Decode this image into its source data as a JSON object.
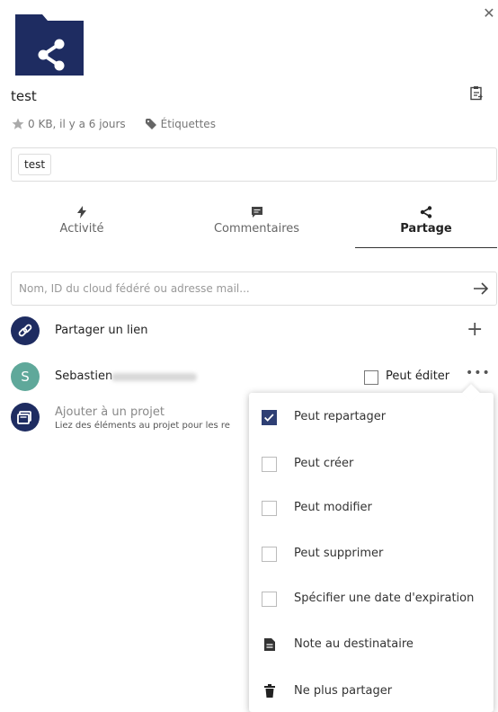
{
  "file": {
    "name": "test",
    "meta": "0 KB, il y a 6 jours",
    "tags_label": "Étiquettes",
    "tags": [
      "test"
    ]
  },
  "tabs": [
    {
      "label": "Activité",
      "icon": "bolt-icon"
    },
    {
      "label": "Commentaires",
      "icon": "comment-icon"
    },
    {
      "label": "Partage",
      "icon": "share-icon",
      "active": true
    }
  ],
  "share_input": {
    "placeholder": "Nom, ID du cloud fédéré ou adresse mail...",
    "value": ""
  },
  "link_share": {
    "label": "Partager un lien"
  },
  "user_share": {
    "initial": "S",
    "name": "Sebastien",
    "can_edit_label": "Peut éditer",
    "can_edit": false,
    "avatar_color": "#5fa89a"
  },
  "project": {
    "title": "Ajouter à un projet",
    "subtitle": "Liez des éléments au projet pour les re"
  },
  "menu": {
    "items": [
      {
        "label": "Peut repartager",
        "type": "checkbox",
        "checked": true
      },
      {
        "label": "Peut créer",
        "type": "checkbox",
        "checked": false
      },
      {
        "label": "Peut modifier",
        "type": "checkbox",
        "checked": false
      },
      {
        "label": "Peut supprimer",
        "type": "checkbox",
        "checked": false
      },
      {
        "label": "Spécifier une date d'expiration",
        "type": "checkbox",
        "checked": false
      },
      {
        "label": "Note au destinataire",
        "type": "action",
        "icon": "note-icon"
      },
      {
        "label": "Ne plus partager",
        "type": "action",
        "icon": "trash-icon"
      }
    ]
  },
  "colors": {
    "brand": "#1e2c61",
    "checkbox_checked": "#2e3f74"
  }
}
